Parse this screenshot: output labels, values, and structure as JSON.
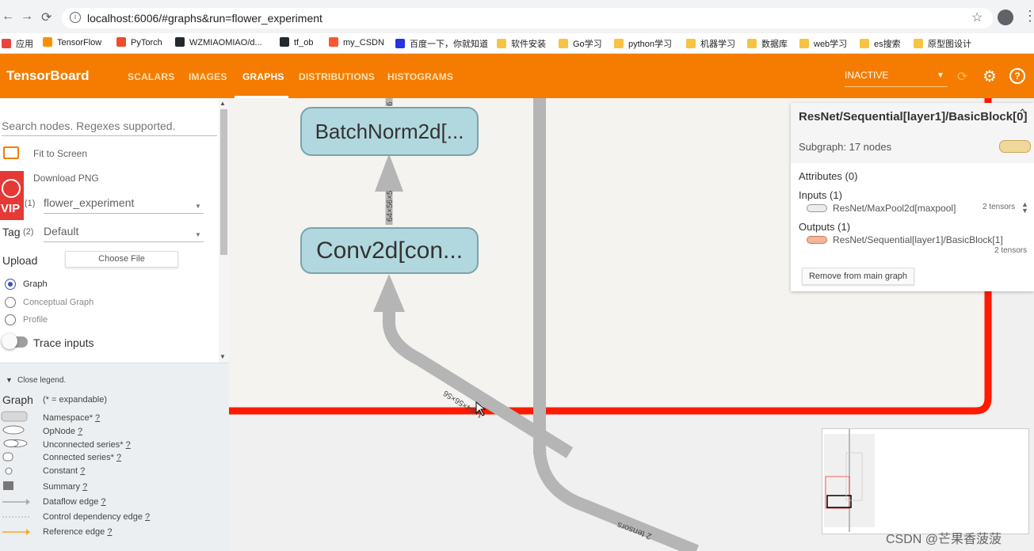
{
  "browser": {
    "url": "localhost:6006/#graphs&run=flower_experiment",
    "bookmarks": [
      {
        "label": "应用",
        "color": "#e8453c"
      },
      {
        "label": "TensorFlow",
        "color": "#ff8f00"
      },
      {
        "label": "PyTorch",
        "color": "#ee4c2c"
      },
      {
        "label": "WZMIAOMIAO/d...",
        "color": "#24292e"
      },
      {
        "label": "tf_ob",
        "color": "#24292e"
      },
      {
        "label": "my_CSDN",
        "color": "#fc5531"
      },
      {
        "label": "百度一下，你就知道",
        "color": "#2932e1"
      },
      {
        "label": "软件安装",
        "color": "#f6c343"
      },
      {
        "label": "Go学习",
        "color": "#f6c343"
      },
      {
        "label": "python学习",
        "color": "#f6c343"
      },
      {
        "label": "机器学习",
        "color": "#f6c343"
      },
      {
        "label": "数据库",
        "color": "#f6c343"
      },
      {
        "label": "web学习",
        "color": "#f6c343"
      },
      {
        "label": "es搜索",
        "color": "#f6c343"
      },
      {
        "label": "原型图设计",
        "color": "#f6c343"
      }
    ]
  },
  "header": {
    "title": "TensorBoard",
    "tabs": [
      {
        "label": "SCALARS",
        "active": false
      },
      {
        "label": "IMAGES",
        "active": false
      },
      {
        "label": "GRAPHS",
        "active": true
      },
      {
        "label": "DISTRIBUTIONS",
        "active": false
      },
      {
        "label": "HISTOGRAMS",
        "active": false
      }
    ],
    "status_select": "INACTIVE",
    "accent_color": "#f57c00"
  },
  "sidebar": {
    "search_placeholder": "Search nodes. Regexes supported.",
    "fit_to_screen": "Fit to Screen",
    "download_png": "Download PNG",
    "badge_text": "VIP",
    "run_count": "(1)",
    "run_value": "flower_experiment",
    "tag_label": "Tag",
    "tag_count": "(2)",
    "tag_value": "Default",
    "upload_label": "Upload",
    "choose_file": "Choose File",
    "graph_modes": [
      {
        "label": "Graph",
        "checked": true
      },
      {
        "label": "Conceptual Graph",
        "checked": false
      },
      {
        "label": "Profile",
        "checked": false
      }
    ],
    "trace_inputs": "Trace inputs"
  },
  "legend": {
    "close_legend": "Close legend.",
    "graph_label": "Graph",
    "expandable_note": "(* = expandable)",
    "items": [
      {
        "label": "Namespace*",
        "q": "?"
      },
      {
        "label": "OpNode",
        "q": "?"
      },
      {
        "label": "Unconnected series*",
        "q": "?"
      },
      {
        "label": "Connected series*",
        "q": "?"
      },
      {
        "label": "Constant",
        "q": "?"
      },
      {
        "label": "Summary",
        "q": "?"
      },
      {
        "label": "Dataflow edge",
        "q": "?"
      },
      {
        "label": "Control dependency edge",
        "q": "?"
      },
      {
        "label": "Reference edge",
        "q": "?"
      }
    ]
  },
  "graph": {
    "nodes": [
      {
        "label": "BatchNorm2d[..."
      },
      {
        "label": "Conv2d[con..."
      }
    ],
    "edge_labels": {
      "top": "64×56×5",
      "diag": "1×64×56×56",
      "tensors": "2 tensors",
      "cut": "6"
    }
  },
  "info_card": {
    "title": "ResNet/Sequential[layer1]/BasicBlock[0]",
    "subtitle": "Subgraph: 17 nodes",
    "attributes": "Attributes (0)",
    "inputs_label": "Inputs (1)",
    "input_item": "ResNet/MaxPool2d[maxpool]",
    "input_tensors": "2 tensors",
    "outputs_label": "Outputs (1)",
    "output_item": "ResNet/Sequential[layer1]/BasicBlock[1]",
    "output_tensors": "2 tensors",
    "remove_button": "Remove from main graph"
  },
  "watermark": "CSDN @芒果香菠菠"
}
